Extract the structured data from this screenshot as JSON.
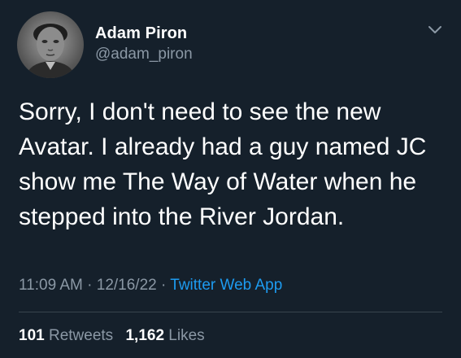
{
  "tweet": {
    "author": {
      "name": "Adam Piron",
      "handle": "@adam_piron"
    },
    "text_lines": [
      "Sorry, I don't need to see the new",
      "Avatar. I already had a guy named JC",
      "show me The Way of Water when he",
      "stepped into the River Jordan."
    ],
    "time": "11:09 AM",
    "date": "12/16/22",
    "separator": "·",
    "app": "Twitter Web App",
    "retweets_count": "101",
    "retweets_label": "Retweets",
    "likes_count": "1,162",
    "likes_label": "Likes"
  },
  "icons": {
    "menu": "chevron-down-icon",
    "avatar": "avatar"
  },
  "colors": {
    "background": "#15202b",
    "text": "#ffffff",
    "secondary": "#8b98a5",
    "link": "#1d9bf0",
    "divider": "#38444d"
  }
}
